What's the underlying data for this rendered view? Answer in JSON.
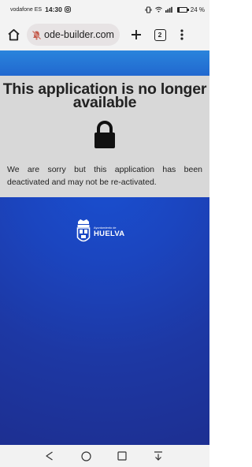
{
  "status_bar": {
    "carrier": "vodafone ES",
    "time": "14:30",
    "battery_percent": "24 %",
    "battery_level": 0.24,
    "icons": [
      "instagram-icon",
      "vibrate-icon",
      "wifi-icon",
      "signal-icon",
      "battery-icon"
    ]
  },
  "browser": {
    "url": "ode-builder.com",
    "tab_count": "2",
    "icons": [
      "home-icon",
      "site-notifications-off-icon",
      "plus-icon",
      "tabs-icon",
      "more-vert-icon"
    ]
  },
  "page": {
    "title": "This application is no longer available",
    "message": "We are sorry but this application has been deactivated and may not be re-activated.",
    "logo": {
      "small_text": "Ayuntamiento de",
      "big_text": "HUELVA"
    },
    "colors": {
      "top_band": "#2a84dc",
      "background": "#1b45bf",
      "notice_bg": "#d8d8d8"
    }
  },
  "nav_bar": {
    "icons": [
      "back-icon",
      "home-circle-icon",
      "recents-icon",
      "download-icon"
    ]
  }
}
